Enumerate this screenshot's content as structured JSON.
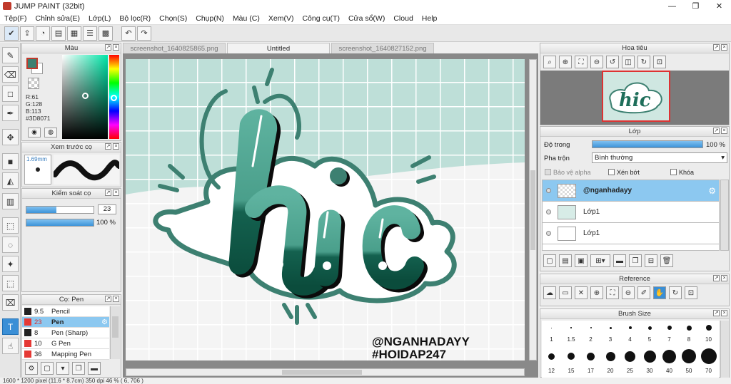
{
  "window": {
    "title": "JUMP PAINT (32bit)",
    "controls": {
      "minimize": "—",
      "restore": "❐",
      "close": "✕"
    }
  },
  "menu": [
    "Tệp(F)",
    "Chỉnh sửa(E)",
    "Lớp(L)",
    "Bộ lọc(R)",
    "Chọn(S)",
    "Chụp(N)",
    "Màu (C)",
    "Xem(V)",
    "Công cụ(T)",
    "Cửa sổ(W)",
    "Cloud",
    "Help"
  ],
  "tabs": [
    {
      "label": "screenshot_1640825865.png",
      "active": false
    },
    {
      "label": "Untitled",
      "active": true
    },
    {
      "label": "screenshot_1640827152.png",
      "active": false
    }
  ],
  "color_panel": {
    "title": "Màu",
    "r": "R:61",
    "g": "G:128",
    "b": "B:113",
    "hex": "#3D8071",
    "main_color": "#3D8071"
  },
  "brush_preview": {
    "title": "Xem trước cọ",
    "size": "1.69mm"
  },
  "brush_control": {
    "title": "Kiểm soát cọ",
    "size_value": "23",
    "opacity_value": "100 %",
    "size_fraction": 0.45,
    "opacity_fraction": 1.0
  },
  "brush_list": {
    "title": "Cọ: Pen",
    "items": [
      {
        "size": "9.5",
        "name": "Pencil",
        "selected": false,
        "red": false
      },
      {
        "size": "23",
        "name": "Pen",
        "selected": true,
        "red": true
      },
      {
        "size": "8",
        "name": "Pen (Sharp)",
        "selected": false,
        "red": false
      },
      {
        "size": "10",
        "name": "G Pen",
        "selected": false,
        "red": true
      },
      {
        "size": "36",
        "name": "Mapping Pen",
        "selected": false,
        "red": true
      }
    ]
  },
  "canvas_art": {
    "signature_line1": "@NGANHADAYY",
    "signature_line2": "#HOIDAP247",
    "background_color": "#bedfd8",
    "ink_color": "#3D8071",
    "dark_color": "#0e5a47"
  },
  "navigator": {
    "title": "Hoa tiêu"
  },
  "layer_panel": {
    "title": "Lớp",
    "opacity_label": "Độ trong",
    "opacity_value": "100 %",
    "blend_label": "Pha trộn",
    "blend_value": "Bình thường",
    "protect_alpha": "Bảo vệ alpha",
    "clipping": "Xén bớt",
    "lock": "Khóa",
    "layers": [
      {
        "name": "@nganhadayy",
        "selected": true
      },
      {
        "name": "Lớp1",
        "selected": false
      },
      {
        "name": "Lớp1",
        "selected": false
      }
    ]
  },
  "reference_panel": {
    "title": "Reference"
  },
  "brush_size_panel": {
    "title": "Brush Size",
    "row1": [
      "1",
      "1.5",
      "2",
      "3",
      "4",
      "5",
      "7",
      "8",
      "10"
    ],
    "row2": [
      "12",
      "15",
      "17",
      "20",
      "25",
      "30",
      "40",
      "50",
      "70"
    ]
  },
  "status": {
    "text": "1600 * 1200 pixel   (11.6 * 8.7cm)   350 dpi   46 %   ( 6, 706 )"
  }
}
